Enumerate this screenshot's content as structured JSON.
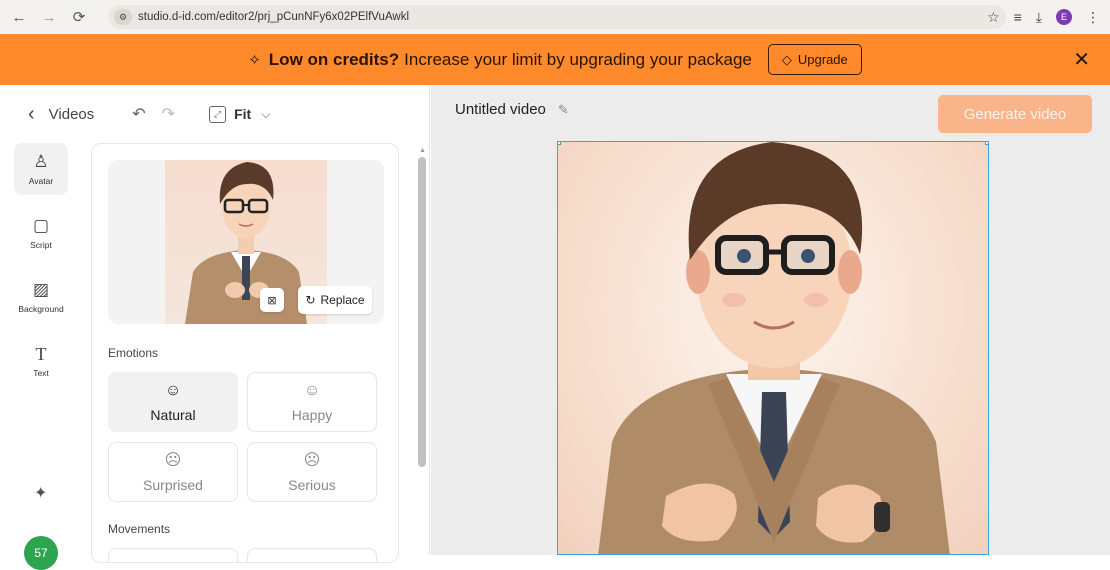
{
  "browser": {
    "url": "studio.d-id.com/editor2/prj_pCunNFy6x02PElfVuAwkl",
    "profile_initial": "E"
  },
  "banner": {
    "bold_text": "Low on credits?",
    "text": "Increase your limit by upgrading your package",
    "upgrade_label": "Upgrade"
  },
  "toolbar": {
    "back_label": "Videos",
    "zoom_label": "Fit"
  },
  "side_nav": {
    "items": [
      {
        "label": "Avatar",
        "icon": "person-icon"
      },
      {
        "label": "Script",
        "icon": "chat-icon"
      },
      {
        "label": "Background",
        "icon": "hatch-icon"
      },
      {
        "label": "Text",
        "icon": "text-icon"
      }
    ],
    "credits": "57"
  },
  "avatar_panel": {
    "replace_label": "Replace",
    "emotions_title": "Emotions",
    "emotions": [
      {
        "label": "Natural",
        "selected": true
      },
      {
        "label": "Happy",
        "selected": false
      },
      {
        "label": "Surprised",
        "selected": false
      },
      {
        "label": "Serious",
        "selected": false
      }
    ],
    "movements_title": "Movements"
  },
  "stage": {
    "video_title": "Untitled video",
    "generate_label": "Generate video",
    "selection_color": "#3aa3e3"
  },
  "colors": {
    "banner": "#ff8a2b",
    "generate_disabled": "#f9b48a",
    "credits_badge": "#2ea44f"
  }
}
